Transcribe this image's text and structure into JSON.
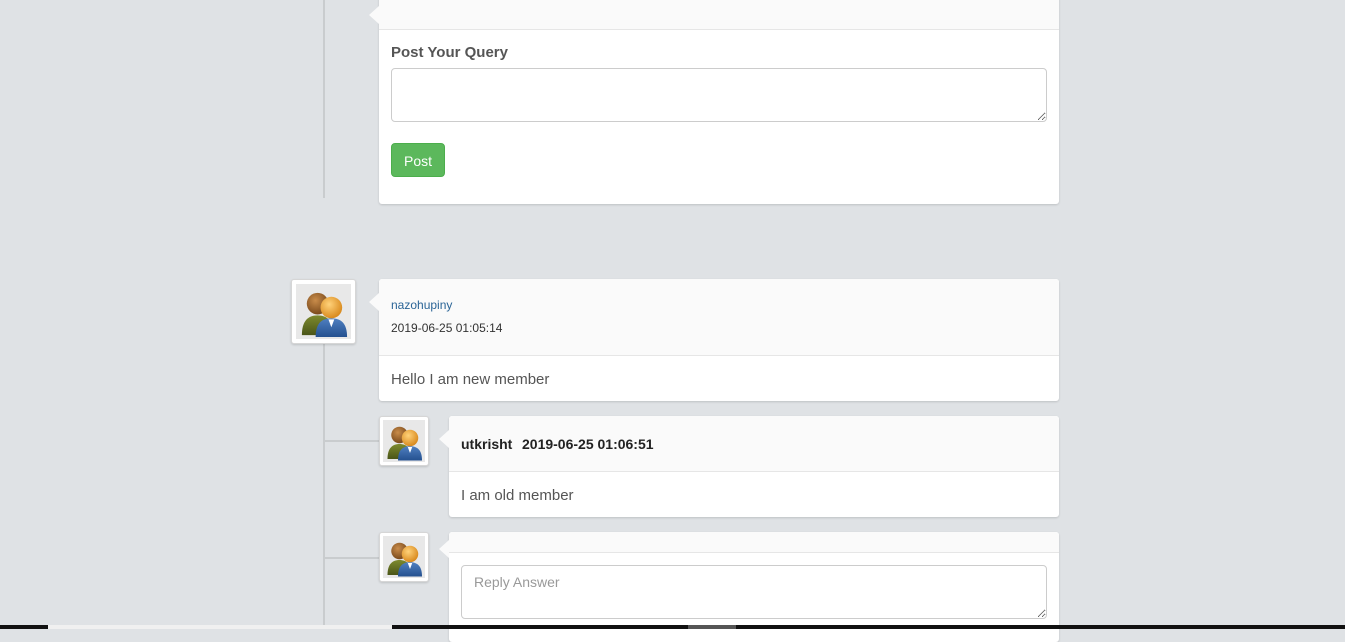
{
  "query_form": {
    "label": "Post Your Query",
    "textarea_value": "",
    "post_button": "Post"
  },
  "post": {
    "author": "nazohupiny",
    "timestamp": "2019-06-25 01:05:14",
    "body": "Hello I am new member",
    "avatar_icon": "users-group-icon"
  },
  "reply": {
    "author": "utkrisht",
    "timestamp": "2019-06-25 01:06:51",
    "body": "I am old member",
    "avatar_icon": "users-group-icon"
  },
  "reply_form": {
    "placeholder": "Reply Answer",
    "avatar_icon": "users-group-icon"
  },
  "colors": {
    "background": "#dfe2e5",
    "post_button": "#5cb85c",
    "author_link": "#2a6496"
  }
}
